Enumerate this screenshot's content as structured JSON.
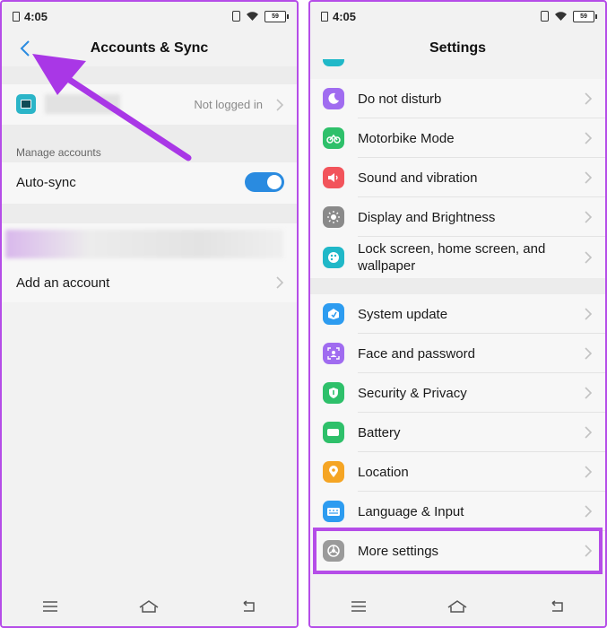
{
  "left": {
    "status": {
      "time": "4:05",
      "battery": "59"
    },
    "title": "Accounts & Sync",
    "account_status": "Not logged in",
    "manage_header": "Manage accounts",
    "auto_sync_label": "Auto-sync",
    "auto_sync_on": true,
    "add_account_label": "Add an account"
  },
  "right": {
    "status": {
      "time": "4:05",
      "battery": "59"
    },
    "title": "Settings",
    "items": [
      {
        "label": "Do not disturb",
        "icon": "moon-icon",
        "color": "#a06cf0"
      },
      {
        "label": "Motorbike Mode",
        "icon": "motorbike-icon",
        "color": "#2ec06a"
      },
      {
        "label": "Sound and vibration",
        "icon": "speaker-icon",
        "color": "#f2545b"
      },
      {
        "label": "Display and Brightness",
        "icon": "brightness-icon",
        "color": "#8a8a8a"
      },
      {
        "label": "Lock screen, home screen, and",
        "label2": "wallpaper",
        "icon": "palette-icon",
        "color": "#20b8c8"
      },
      {
        "label": "System update",
        "icon": "update-icon",
        "color": "#2d9cf0"
      },
      {
        "label": "Face and password",
        "icon": "face-id-icon",
        "color": "#a06cf0"
      },
      {
        "label": "Security & Privacy",
        "icon": "shield-icon",
        "color": "#2ec06a"
      },
      {
        "label": "Battery",
        "icon": "battery-icon",
        "color": "#2ec06a"
      },
      {
        "label": "Location",
        "icon": "location-pin-icon",
        "color": "#f5a524"
      },
      {
        "label": "Language & Input",
        "icon": "keyboard-icon",
        "color": "#2d9cf0"
      },
      {
        "label": "More settings",
        "icon": "more-settings-icon",
        "color": "#9a9a9a"
      }
    ]
  },
  "colors": {
    "accent": "#b54de8",
    "toggle": "#2a8be0",
    "back": "#2a8be0"
  }
}
